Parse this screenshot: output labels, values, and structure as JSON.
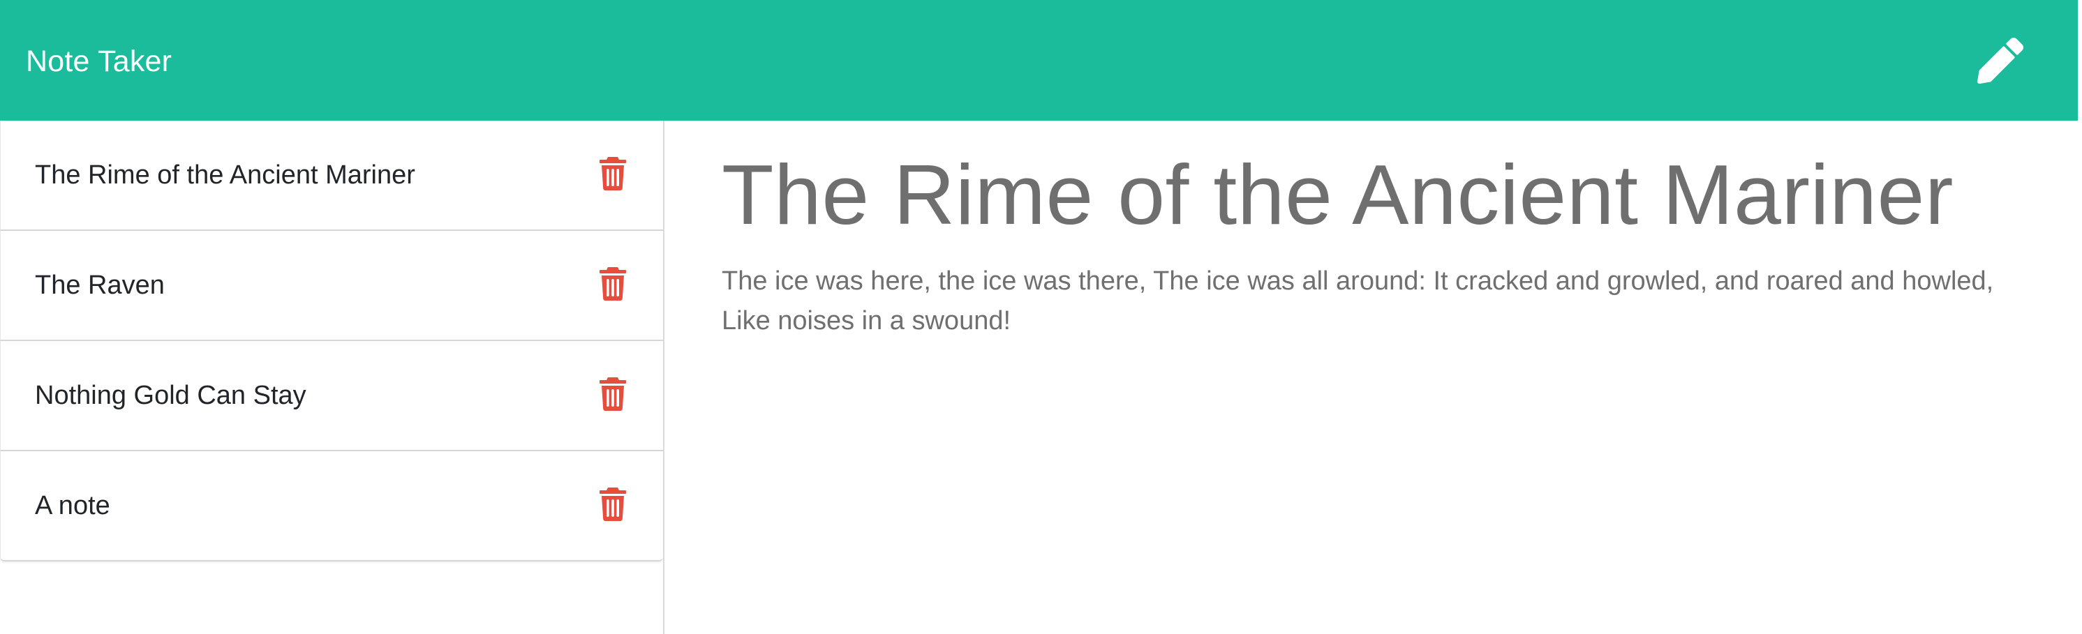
{
  "navbar": {
    "brand": "Note Taker",
    "edit_icon": "pencil-icon",
    "background": "#1abc9c"
  },
  "sidebar": {
    "delete_icon": "trash-icon",
    "delete_color": "#e74c3c",
    "notes": [
      {
        "title": "The Rime of the Ancient Mariner"
      },
      {
        "title": "The Raven"
      },
      {
        "title": "Nothing Gold Can Stay"
      },
      {
        "title": "A note"
      }
    ]
  },
  "editor": {
    "title": "The Rime of the Ancient Mariner",
    "text": "The ice was here, the ice was there, The ice was all around: It cracked and growled, and roared and howled, Like noises in a swound!"
  }
}
